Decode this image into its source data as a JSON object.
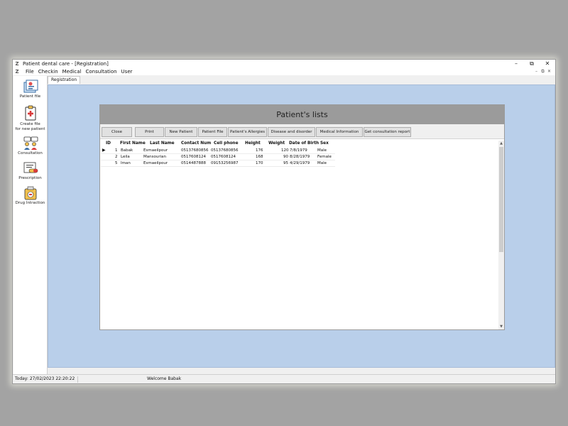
{
  "window": {
    "title": "Patient dental care - [Registration]"
  },
  "menu": [
    "File",
    "Checkin",
    "Medical",
    "Consultation",
    "User"
  ],
  "sidebar": {
    "items": [
      {
        "label": "Patient file",
        "icon": "patient-file-icon"
      },
      {
        "label_line1": "Create file",
        "label_line2": "for new patient",
        "icon": "clipboard-plus-icon"
      },
      {
        "label": "Consultation",
        "icon": "consultation-icon"
      },
      {
        "label": "Prescription",
        "icon": "prescription-icon"
      },
      {
        "label": "Drug Intraction",
        "icon": "drug-interaction-icon"
      }
    ]
  },
  "tabs": [
    "Registration"
  ],
  "panel": {
    "title": "Patient's lists",
    "buttons": {
      "close": "Close",
      "print": "Print",
      "new_patient": "New Patient",
      "patient_file": "Patient File",
      "allergies": "Patient's Allergies",
      "disease": "Disease and disorder",
      "medical_info": "Medical Information",
      "consultation_report": "Get consultation report"
    }
  },
  "table": {
    "columns": [
      "ID",
      "First Name",
      "Last Name",
      "Contact Num",
      "Cell phone",
      "Height",
      "Weight",
      "Date of Birth",
      "Sex"
    ],
    "rows": [
      [
        "1",
        "Babak",
        "Esmaeilpour",
        "05137680856",
        "05137680856",
        "176",
        "120",
        "7/8/1979",
        "Male"
      ],
      [
        "2",
        "Leila",
        "Mansourian",
        "0517608124",
        "0517608124",
        "168",
        "90",
        "8/28/1979",
        "Female"
      ],
      [
        "5",
        "Iman",
        "Esmaeilpour",
        "0514487888",
        "09153256987",
        "170",
        "95",
        "4/29/1979",
        "Male"
      ]
    ]
  },
  "status": {
    "today": "Today: 27/02/2023 22:20:22",
    "welcome": "Welcome Babak"
  },
  "colors": {
    "mdi_background": "#b9cfea",
    "panel_header": "#9b9b9b"
  }
}
